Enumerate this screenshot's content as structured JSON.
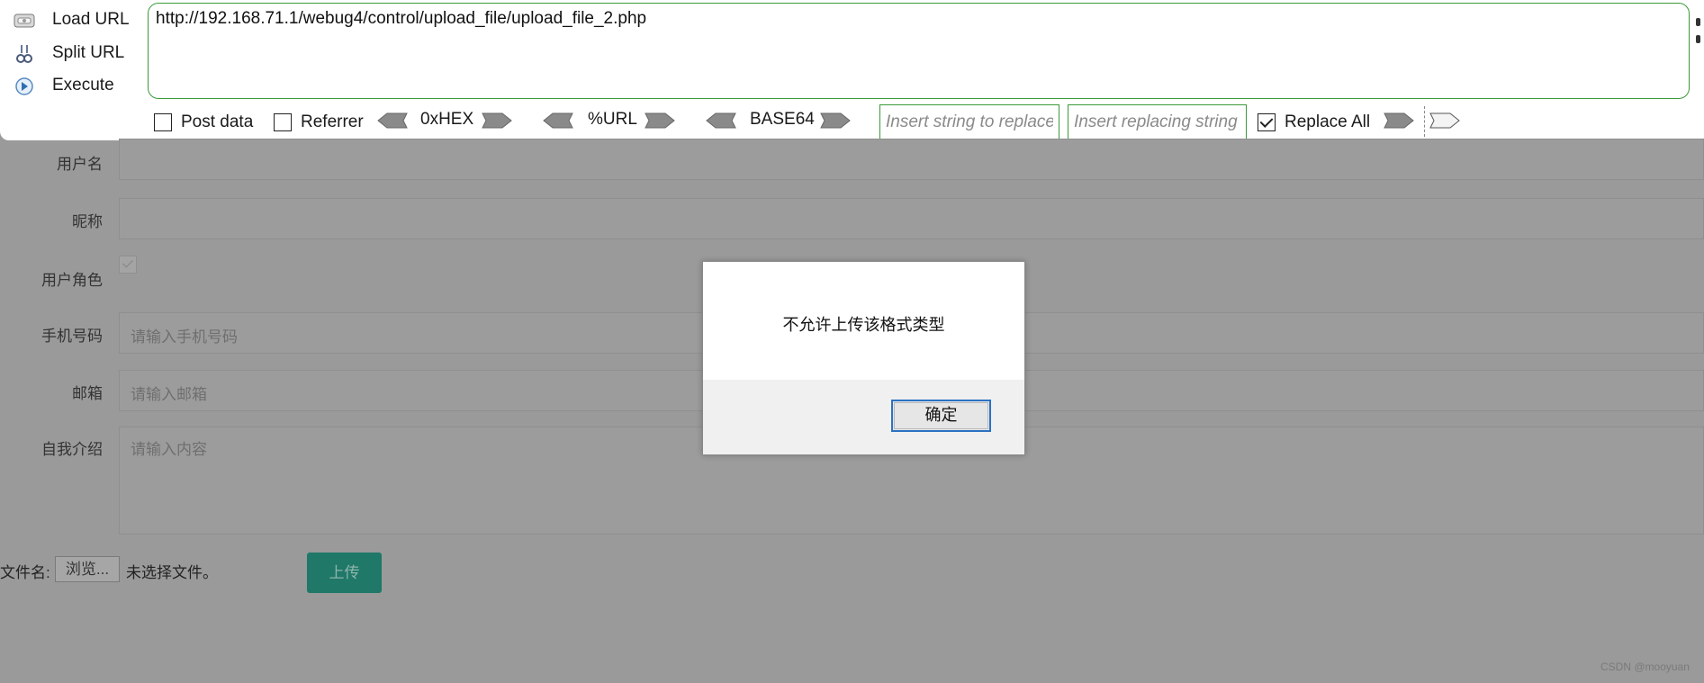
{
  "hackbar": {
    "actions": [
      {
        "label": "Load URL",
        "icon": "load-url-icon"
      },
      {
        "label": "Split URL",
        "icon": "split-url-icon"
      },
      {
        "label": "Execute",
        "icon": "execute-icon"
      }
    ],
    "url": "http://192.168.71.1/webug4/control/upload_file/upload_file_2.php",
    "post_data_label": "Post data",
    "post_data_checked": false,
    "referrer_label": "Referrer",
    "referrer_checked": false,
    "encoders": [
      "0xHEX",
      "%URL",
      "BASE64"
    ],
    "replace_find_placeholder": "Insert string to replace",
    "replace_with_placeholder": "Insert replacing string",
    "replace_all_label": "Replace All",
    "replace_all_checked": true,
    "accent_color": "#3a9a3a"
  },
  "form": {
    "username_label": "用户名",
    "nickname_label": "昵称",
    "role_label": "用户角色",
    "phone_label": "手机号码",
    "phone_placeholder": "请输入手机号码",
    "email_label": "邮箱",
    "email_placeholder": "请输入邮箱",
    "intro_label": "自我介绍",
    "intro_placeholder": "请输入内容",
    "file_name_label": "文件名:",
    "browse_label": "浏览...",
    "no_file_text": "未选择文件。",
    "upload_label": "上传",
    "upload_color": "#1f7868"
  },
  "dialog": {
    "message": "不允许上传该格式类型",
    "ok_label": "确定"
  },
  "watermark": "CSDN @mooyuan"
}
